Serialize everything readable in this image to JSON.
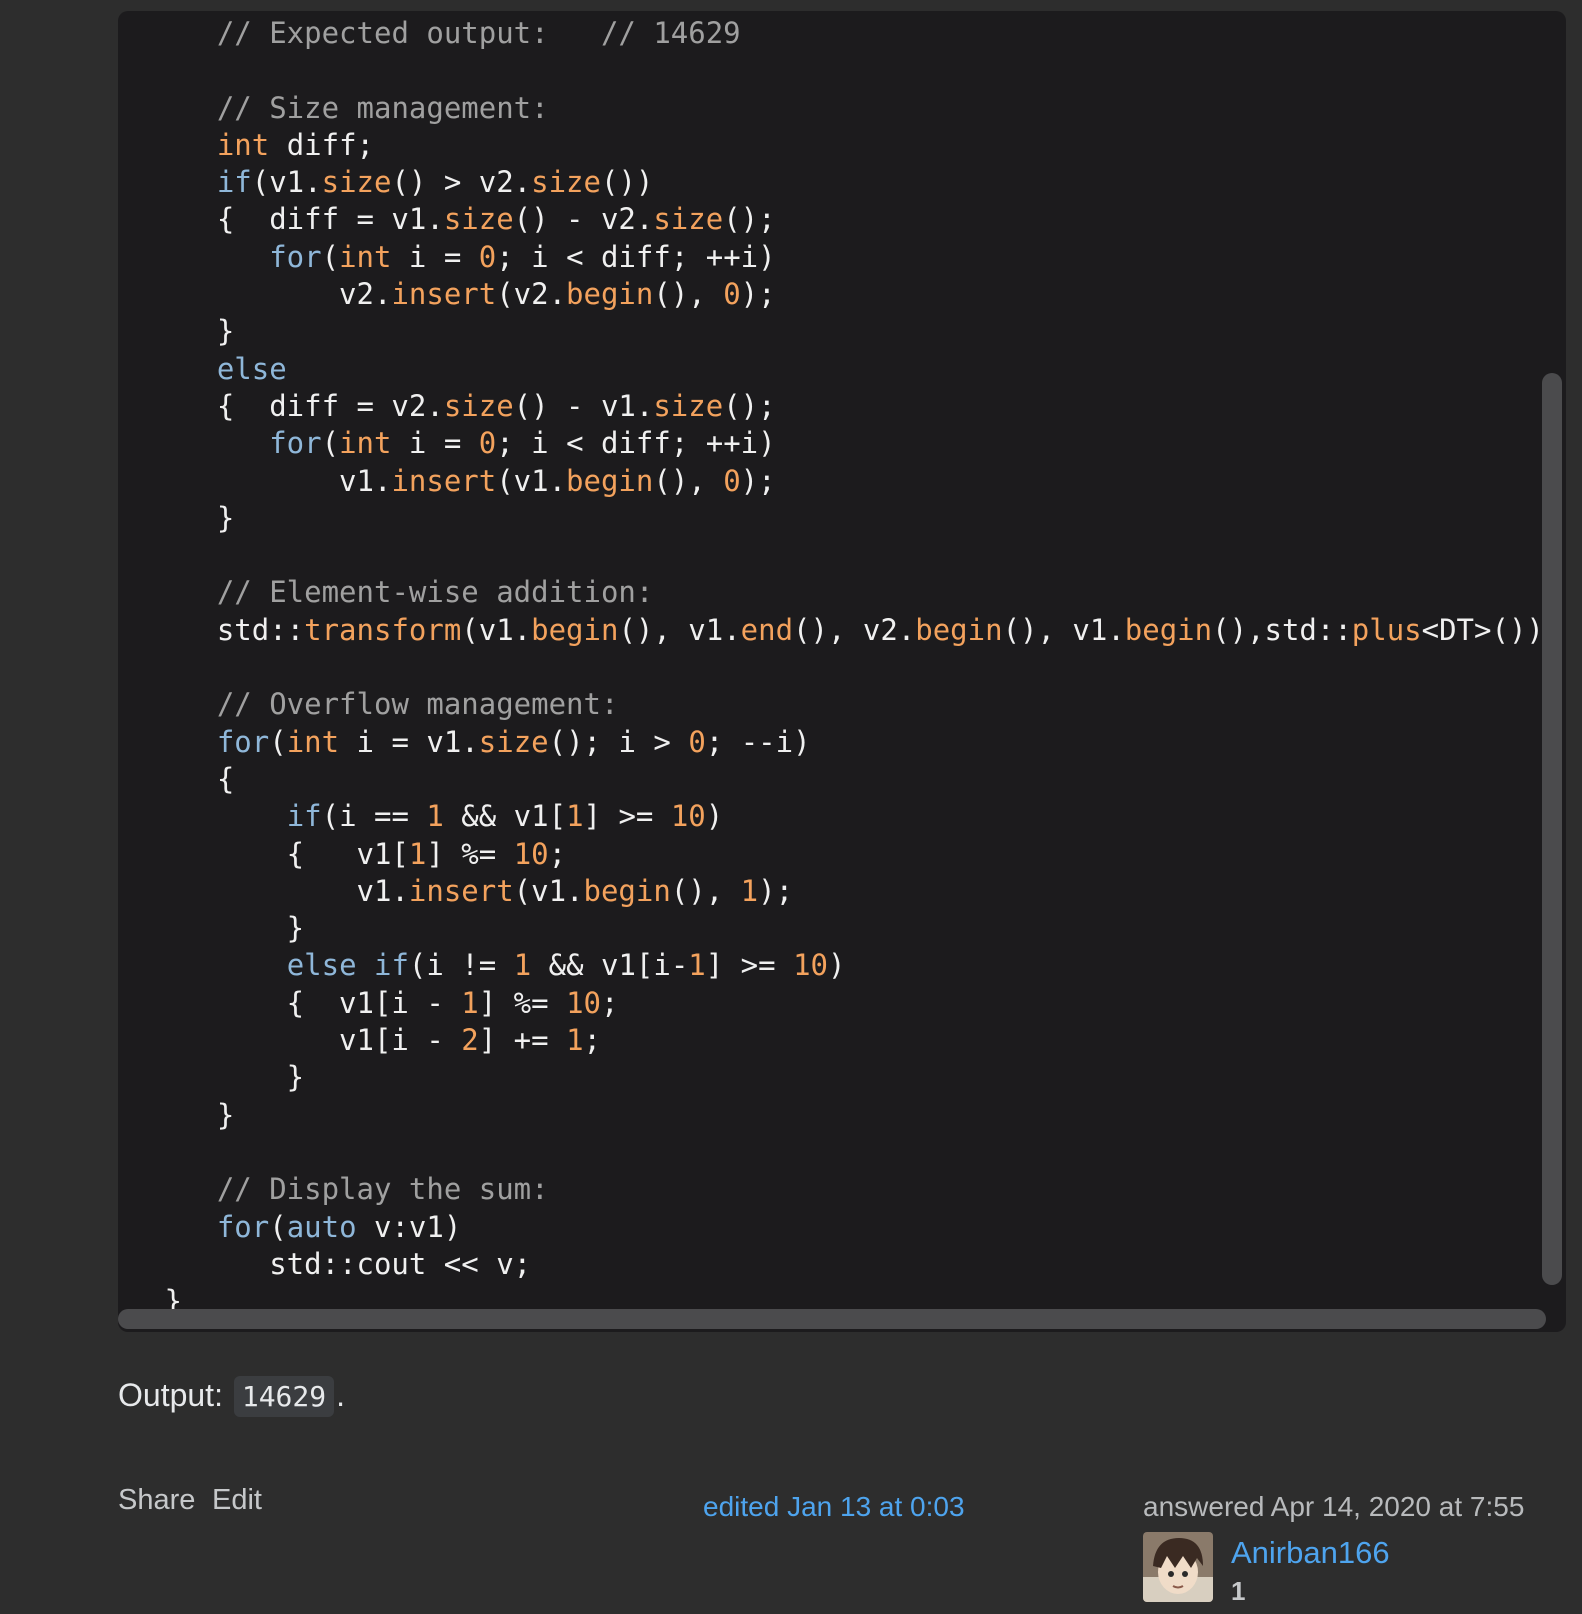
{
  "code_lines": [
    [
      {
        "t": "    "
      },
      {
        "t": "// Expected output:   // 14629",
        "c": "cm"
      }
    ],
    [],
    [
      {
        "t": "    "
      },
      {
        "t": "// Size management:",
        "c": "cm"
      }
    ],
    [
      {
        "t": "    "
      },
      {
        "t": "int",
        "c": "ty"
      },
      {
        "t": " diff;"
      }
    ],
    [
      {
        "t": "    "
      },
      {
        "t": "if",
        "c": "kw"
      },
      {
        "t": "(v1."
      },
      {
        "t": "size",
        "c": "fn"
      },
      {
        "t": "() > v2."
      },
      {
        "t": "size",
        "c": "fn"
      },
      {
        "t": "())"
      }
    ],
    [
      {
        "t": "    {  diff = v1."
      },
      {
        "t": "size",
        "c": "fn"
      },
      {
        "t": "() - v2."
      },
      {
        "t": "size",
        "c": "fn"
      },
      {
        "t": "();"
      }
    ],
    [
      {
        "t": "       "
      },
      {
        "t": "for",
        "c": "kw"
      },
      {
        "t": "("
      },
      {
        "t": "int",
        "c": "ty"
      },
      {
        "t": " i = "
      },
      {
        "t": "0",
        "c": "nu"
      },
      {
        "t": "; i < diff; ++i)"
      }
    ],
    [
      {
        "t": "           v2."
      },
      {
        "t": "insert",
        "c": "fn"
      },
      {
        "t": "(v2."
      },
      {
        "t": "begin",
        "c": "fn"
      },
      {
        "t": "(), "
      },
      {
        "t": "0",
        "c": "nu"
      },
      {
        "t": ");"
      }
    ],
    [
      {
        "t": "    }"
      }
    ],
    [
      {
        "t": "    "
      },
      {
        "t": "else",
        "c": "kw"
      }
    ],
    [
      {
        "t": "    {  diff = v2."
      },
      {
        "t": "size",
        "c": "fn"
      },
      {
        "t": "() - v1."
      },
      {
        "t": "size",
        "c": "fn"
      },
      {
        "t": "();"
      }
    ],
    [
      {
        "t": "       "
      },
      {
        "t": "for",
        "c": "kw"
      },
      {
        "t": "("
      },
      {
        "t": "int",
        "c": "ty"
      },
      {
        "t": " i = "
      },
      {
        "t": "0",
        "c": "nu"
      },
      {
        "t": "; i < diff; ++i)"
      }
    ],
    [
      {
        "t": "           v1."
      },
      {
        "t": "insert",
        "c": "fn"
      },
      {
        "t": "(v1."
      },
      {
        "t": "begin",
        "c": "fn"
      },
      {
        "t": "(), "
      },
      {
        "t": "0",
        "c": "nu"
      },
      {
        "t": ");"
      }
    ],
    [
      {
        "t": "    }"
      }
    ],
    [],
    [
      {
        "t": "    "
      },
      {
        "t": "// Element-wise addition:",
        "c": "cm"
      }
    ],
    [
      {
        "t": "    std::"
      },
      {
        "t": "transform",
        "c": "fn"
      },
      {
        "t": "(v1."
      },
      {
        "t": "begin",
        "c": "fn"
      },
      {
        "t": "(), v1."
      },
      {
        "t": "end",
        "c": "fn"
      },
      {
        "t": "(), v2."
      },
      {
        "t": "begin",
        "c": "fn"
      },
      {
        "t": "(), v1."
      },
      {
        "t": "begin",
        "c": "fn"
      },
      {
        "t": "(),std::"
      },
      {
        "t": "plus",
        "c": "fn"
      },
      {
        "t": "<DT>());"
      }
    ],
    [],
    [
      {
        "t": "    "
      },
      {
        "t": "// Overflow management:",
        "c": "cm"
      }
    ],
    [
      {
        "t": "    "
      },
      {
        "t": "for",
        "c": "kw"
      },
      {
        "t": "("
      },
      {
        "t": "int",
        "c": "ty"
      },
      {
        "t": " i = v1."
      },
      {
        "t": "size",
        "c": "fn"
      },
      {
        "t": "(); i > "
      },
      {
        "t": "0",
        "c": "nu"
      },
      {
        "t": "; --i)"
      }
    ],
    [
      {
        "t": "    {"
      }
    ],
    [
      {
        "t": "        "
      },
      {
        "t": "if",
        "c": "kw"
      },
      {
        "t": "(i == "
      },
      {
        "t": "1",
        "c": "nu"
      },
      {
        "t": " && v1["
      },
      {
        "t": "1",
        "c": "nu"
      },
      {
        "t": "] >= "
      },
      {
        "t": "10",
        "c": "nu"
      },
      {
        "t": ")"
      }
    ],
    [
      {
        "t": "        {   v1["
      },
      {
        "t": "1",
        "c": "nu"
      },
      {
        "t": "] %= "
      },
      {
        "t": "10",
        "c": "nu"
      },
      {
        "t": ";"
      }
    ],
    [
      {
        "t": "            v1."
      },
      {
        "t": "insert",
        "c": "fn"
      },
      {
        "t": "(v1."
      },
      {
        "t": "begin",
        "c": "fn"
      },
      {
        "t": "(), "
      },
      {
        "t": "1",
        "c": "nu"
      },
      {
        "t": ");"
      }
    ],
    [
      {
        "t": "        }"
      }
    ],
    [
      {
        "t": "        "
      },
      {
        "t": "else",
        "c": "kw"
      },
      {
        "t": " "
      },
      {
        "t": "if",
        "c": "kw"
      },
      {
        "t": "(i != "
      },
      {
        "t": "1",
        "c": "nu"
      },
      {
        "t": " && v1[i-"
      },
      {
        "t": "1",
        "c": "nu"
      },
      {
        "t": "] >= "
      },
      {
        "t": "10",
        "c": "nu"
      },
      {
        "t": ")"
      }
    ],
    [
      {
        "t": "        {  v1[i - "
      },
      {
        "t": "1",
        "c": "nu"
      },
      {
        "t": "] %= "
      },
      {
        "t": "10",
        "c": "nu"
      },
      {
        "t": ";"
      }
    ],
    [
      {
        "t": "           v1[i - "
      },
      {
        "t": "2",
        "c": "nu"
      },
      {
        "t": "] += "
      },
      {
        "t": "1",
        "c": "nu"
      },
      {
        "t": ";"
      }
    ],
    [
      {
        "t": "        }"
      }
    ],
    [
      {
        "t": "    }"
      }
    ],
    [],
    [
      {
        "t": "    "
      },
      {
        "t": "// Display the sum:",
        "c": "cm"
      }
    ],
    [
      {
        "t": "    "
      },
      {
        "t": "for",
        "c": "kw"
      },
      {
        "t": "("
      },
      {
        "t": "auto",
        "c": "kw"
      },
      {
        "t": " v:v1)"
      }
    ],
    [
      {
        "t": "       std::cout << v;"
      }
    ],
    [
      {
        "t": " }"
      }
    ]
  ],
  "output": {
    "label": "Output:",
    "value": "14629",
    "suffix": "."
  },
  "post_menu": {
    "share": "Share",
    "edit": "Edit"
  },
  "edited": "edited Jan 13 at 0:03",
  "answered": "answered Apr 14, 2020 at 7:55",
  "user": {
    "name": "Anirban166",
    "reputation": "1"
  }
}
